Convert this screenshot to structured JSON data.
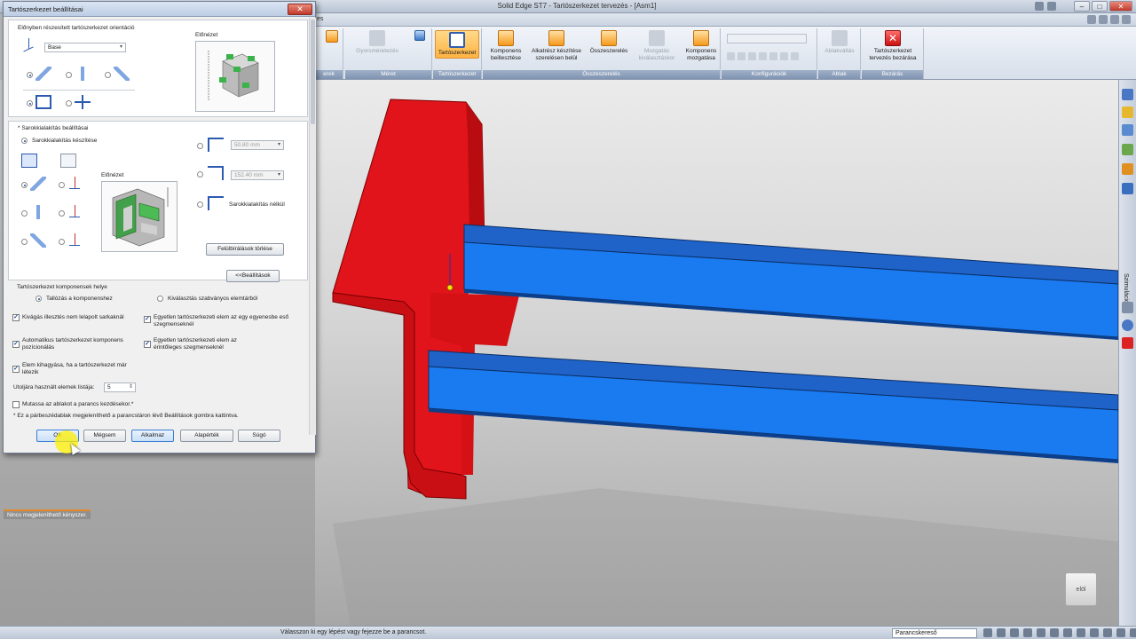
{
  "app": {
    "title": "Solid Edge ST7 - Tartószerkezet tervezés - [Asm1]",
    "menu_fragment": "es",
    "left_fragment_1": "szerek",
    "left_fragment_2": "erek"
  },
  "ribbon": {
    "groups": [
      {
        "label": "Méret",
        "buttons": [
          {
            "label": "Gyorsméretezés",
            "enabled": false
          }
        ]
      },
      {
        "label": "Tartószerkezet",
        "buttons": [
          {
            "label": "Tartószerkezet",
            "enabled": true,
            "active": true
          }
        ]
      },
      {
        "label": "Összeszerelés",
        "buttons": [
          {
            "label": "Komponens beillesztése",
            "enabled": true
          },
          {
            "label": "Alkatrész készítése szerelésen belül",
            "enabled": true
          },
          {
            "label": "Összeszerelés",
            "enabled": true
          },
          {
            "label": "Mozgatás kiválasztáskor",
            "enabled": false
          },
          {
            "label": "Komponens mozgatása",
            "enabled": true
          }
        ]
      },
      {
        "label": "Konfigurációk"
      },
      {
        "label": "Ablak",
        "buttons": [
          {
            "label": "Ablakváltás",
            "enabled": false
          }
        ]
      },
      {
        "label": "Bezárás",
        "buttons": [
          {
            "label": "Tartószerkezet tervezés bezárása",
            "enabled": true
          }
        ]
      }
    ]
  },
  "dialog": {
    "title": "Tartószerkezet beállításai",
    "orientation_label": "Előnyben részesített tartószerkezet orientáció",
    "orientation_combo": "Base",
    "preview_label": "Előnézet",
    "corner_section_label": "* Sarokkialakítás beállításai",
    "corner_create_label": "Sarokkialakítás készítése",
    "corner_preview_label": "Előnézet",
    "dim1": "50.80 mm",
    "dim2": "152.40 mm",
    "no_corner_label": "Sarokkialakítás nélkül",
    "remove_overrides_button": "Felülbírálások törlése",
    "settings_button": "<<Beállítások",
    "component_location_label": "Tartószerkezet komponensek helye",
    "browse_option": "Tallózás a komponenshez",
    "select_std_option": "Kiválasztás szabványos elemtárból",
    "checks": [
      {
        "label": "Kivágás illesztés nem lelapolt sarkaknál",
        "checked": true
      },
      {
        "label": "Egyetlen tartószerkezeti elem az egy egyenesbe eső szegmenseknél",
        "checked": true
      },
      {
        "label": "Automatikus tartószerkezet komponens pozícionálás",
        "checked": true
      },
      {
        "label": "Egyetlen tartószerkezeti elem az érintőleges szegmenseknél",
        "checked": true
      },
      {
        "label": "Elem kihagyása, ha a tartószerkezet már létezik",
        "checked": true
      },
      {
        "label": "Mutassa az ablakot a parancs kezdésekor.*",
        "checked": false
      }
    ],
    "recent_list_label": "Utoljára használt elemek listája:",
    "recent_list_value": "5",
    "footnote": "* Ez a párbeszédablak megjeleníthető a parancstáron lévő Beállítások gombra kattintva.",
    "buttons": {
      "ok": "OK",
      "cancel": "Mégsem",
      "apply": "Alkalmaz",
      "defaults": "Alapérték",
      "help": "Súgó"
    }
  },
  "viewport": {
    "constraint_tip": "Nincs megjeleníthető kényszer.",
    "viewcube_label": "elöl",
    "colors": {
      "red_member": "#e0141a",
      "blue_member": "#1a6fe8"
    }
  },
  "sidetab": {
    "label": "Szimuláció"
  },
  "statusbar": {
    "message": "Válasszon ki egy lépést vagy fejezze be a parancsot.",
    "command_finder": "Parancskereső"
  }
}
